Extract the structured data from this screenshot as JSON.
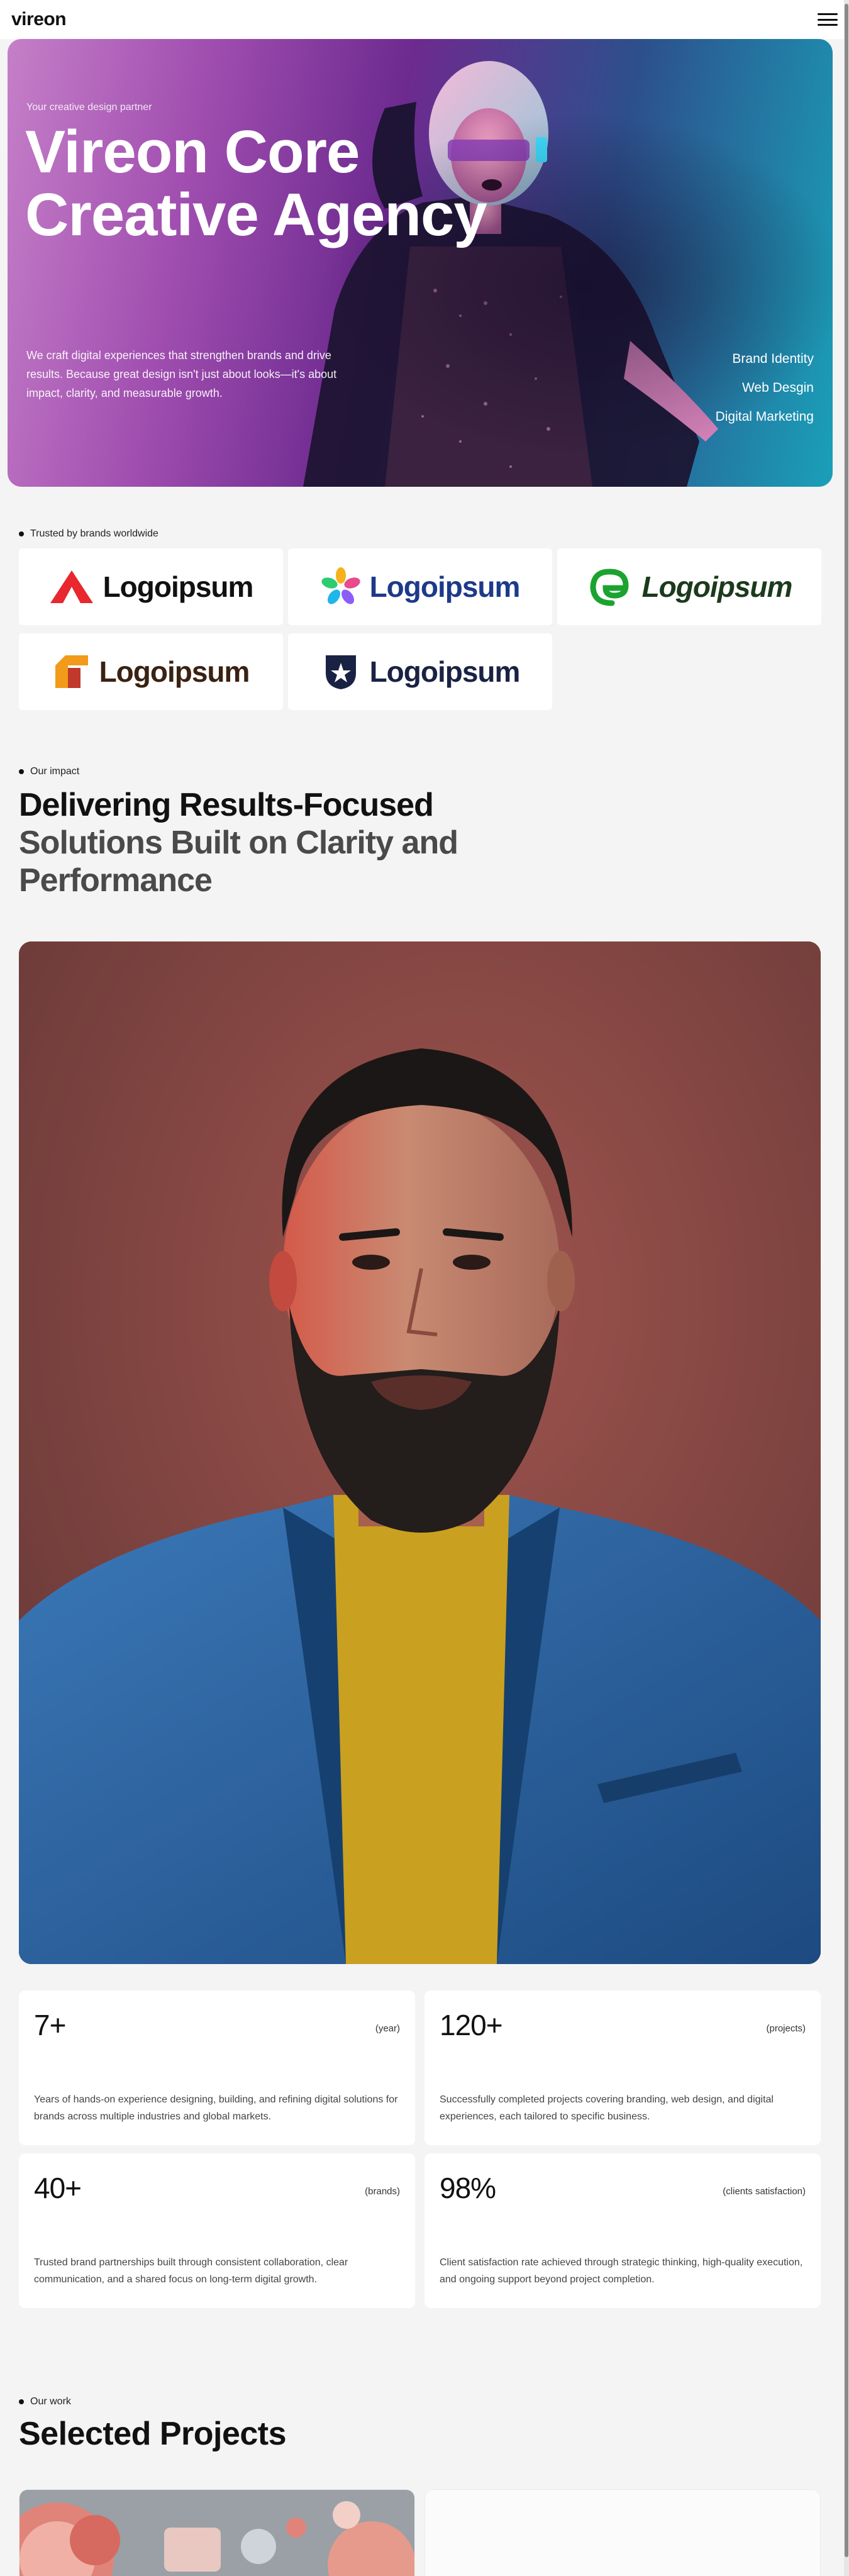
{
  "header": {
    "brand": "vireon",
    "menu_icon": "hamburger-menu-icon"
  },
  "hero": {
    "kicker": "Your creative design partner",
    "title_line1": "Vireon Core",
    "title_line2": "Creative Agency",
    "description": "We craft digital experiences that strengthen brands and drive results. Because great design isn't just about looks—it's about impact, clarity, and measurable growth.",
    "services": [
      "Brand Identity",
      "Web Desgin",
      "Digital Marketing"
    ]
  },
  "trusted": {
    "label": "Trusted by brands worldwide",
    "logos": [
      {
        "name": "Logoipsum",
        "icon": "red-triangle-mark-icon",
        "color": "#e8272e"
      },
      {
        "name": "Logoipsum",
        "icon": "pinwheel-flower-icon",
        "color": "#1d3a8a"
      },
      {
        "name": "Logoipsum",
        "icon": "green-swirl-icon",
        "color": "#1aa32f"
      },
      {
        "name": "Logoipsum",
        "icon": "orange-block-mark-icon",
        "color": "#3a2212"
      },
      {
        "name": "Logoipsum",
        "icon": "star-shield-icon",
        "color": "#1a2244"
      }
    ]
  },
  "impact": {
    "label": "Our impact",
    "title_line1": "Delivering Results-Focused",
    "title_line2": "Solutions Built on Clarity and",
    "title_line3": "Performance"
  },
  "stats": [
    {
      "value": "7+",
      "tag": "(year)",
      "description": "Years of hands-on experience designing, building, and refining digital solutions for brands across multiple industries and global markets."
    },
    {
      "value": "120+",
      "tag": "(projects)",
      "description": "Successfully completed projects covering branding, web design, and digital experiences, each tailored to specific business."
    },
    {
      "value": "40+",
      "tag": "(brands)",
      "description": "Trusted brand partnerships built through consistent collaboration, clear communication, and a shared focus on long-term digital growth."
    },
    {
      "value": "98%",
      "tag": "(clients satisfaction)",
      "description": "Client satisfaction rate achieved through strategic thinking, high-quality execution, and ongoing support beyond project completion."
    }
  ],
  "work": {
    "label": "Our work",
    "title": "Selected Projects"
  }
}
